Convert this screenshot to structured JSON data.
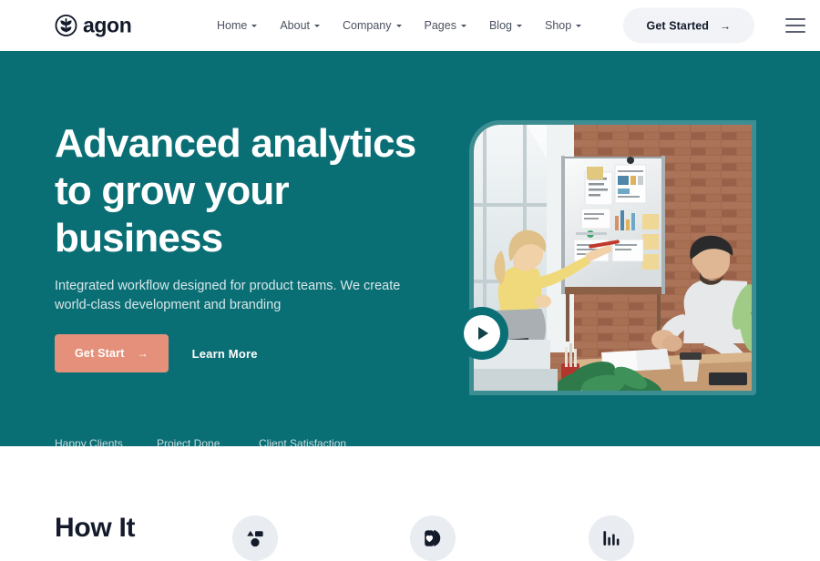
{
  "brand": {
    "name": "agon",
    "logo_icon": "leaf-emblem-icon",
    "color": "#131B2B"
  },
  "header": {
    "nav_items": [
      {
        "label": "Home",
        "has_dropdown": true
      },
      {
        "label": "About",
        "has_dropdown": true
      },
      {
        "label": "Company",
        "has_dropdown": true
      },
      {
        "label": "Pages",
        "has_dropdown": true
      },
      {
        "label": "Blog",
        "has_dropdown": true
      },
      {
        "label": "Shop",
        "has_dropdown": true
      }
    ],
    "cta": {
      "label": "Get Started",
      "arrow": "→"
    },
    "menu_icon": "hamburger-menu-icon"
  },
  "hero": {
    "background_color": "#0A6E75",
    "title": "Advanced analytics to grow your business",
    "subtitle": "Integrated workflow designed for product teams. We create world-class development and branding",
    "primary_button": {
      "label": "Get Start",
      "arrow": "→",
      "color": "#E5907A"
    },
    "secondary_button": {
      "label": "Learn More"
    },
    "stats": [
      {
        "value": "",
        "label": "Happy Clients"
      },
      {
        "value": "",
        "label": "Project Done"
      },
      {
        "value": "",
        "label": "Client Satisfaction"
      }
    ],
    "media": {
      "alt": "Two colleagues in a brick-walled office reviewing charts on a whiteboard",
      "frame_color": "#3C8E92",
      "play_button_icon": "play-icon"
    }
  },
  "how_section": {
    "title": "How It",
    "features": [
      {
        "icon": "shapes-icon"
      },
      {
        "icon": "heart-card-icon"
      },
      {
        "icon": "bar-chart-icon"
      }
    ]
  }
}
